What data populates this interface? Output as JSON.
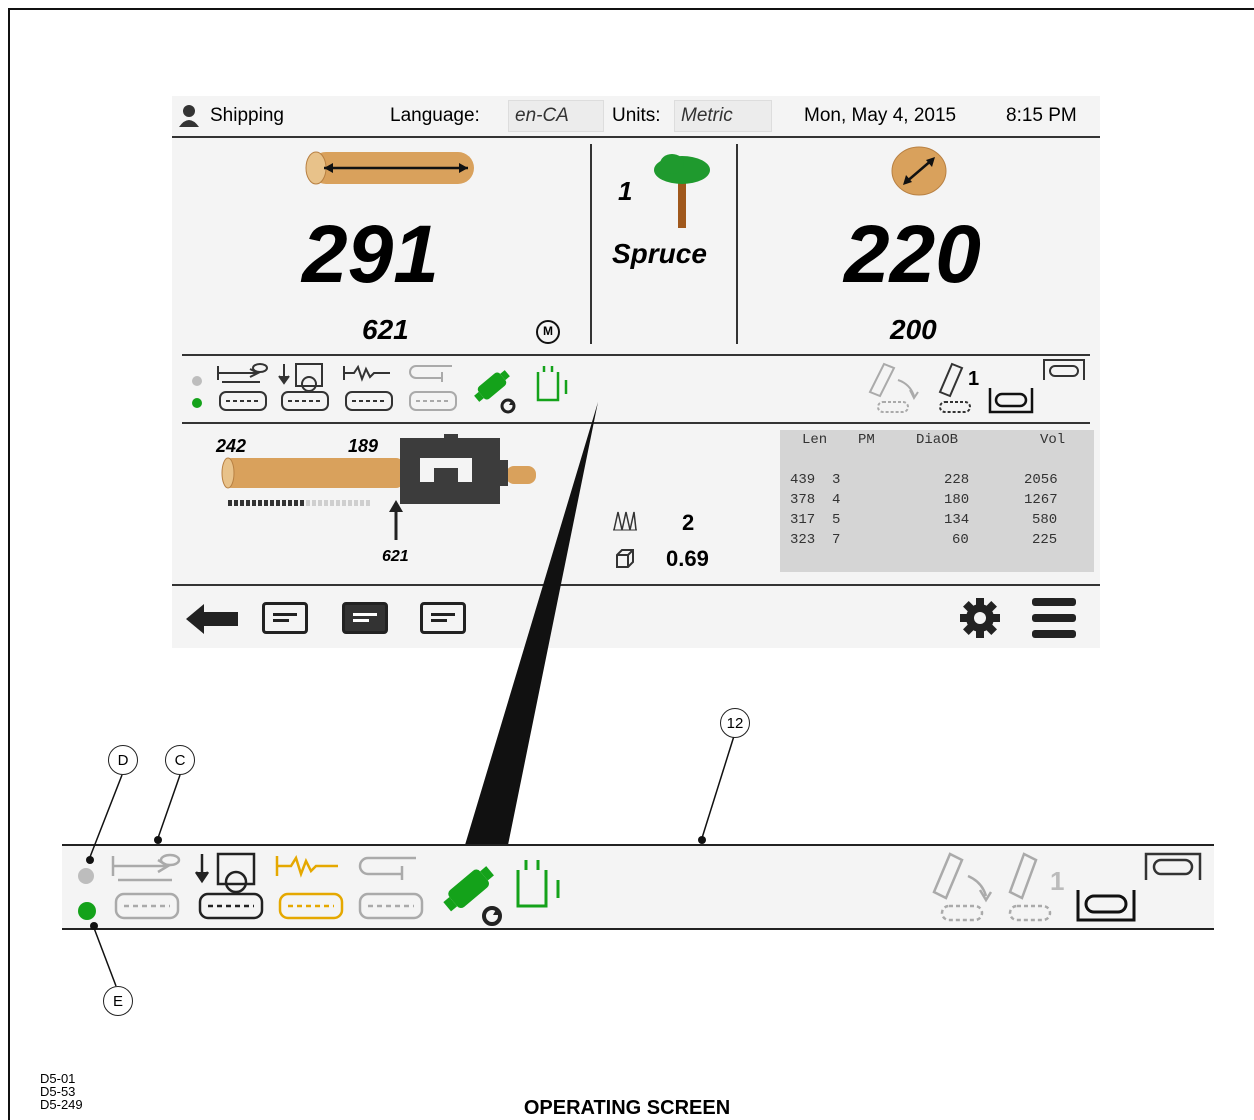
{
  "header": {
    "user_name": "Shipping",
    "language_label": "Language:",
    "language_value": "en-CA",
    "units_label": "Units:",
    "units_value": "Metric",
    "date": "Mon, May 4, 2015",
    "time": "8:15 PM"
  },
  "length": {
    "main": "291",
    "sub": "621",
    "mode_badge": "M"
  },
  "species": {
    "number": "1",
    "name": "Spruce"
  },
  "diameter": {
    "main": "220",
    "sub": "200"
  },
  "feed": {
    "top_left": "242",
    "top_right": "189",
    "bottom": "621"
  },
  "counters": {
    "count": "2",
    "volume": "0.69"
  },
  "cut_icon_number": "1",
  "table": {
    "headers": [
      "Len",
      "PM",
      "DiaOB",
      "Vol"
    ],
    "rows": [
      [
        "439",
        "3",
        "228",
        "2056"
      ],
      [
        "378",
        "4",
        "180",
        "1267"
      ],
      [
        "317",
        "5",
        "134",
        "580"
      ],
      [
        "323",
        "7",
        "60",
        "225"
      ]
    ]
  },
  "callouts": {
    "c12": "12",
    "d": "D",
    "c": "C",
    "e": "E"
  },
  "doc_refs": [
    "D5-01",
    "D5-53",
    "D5-249"
  ],
  "caption": "OPERATING SCREEN",
  "colors": {
    "wood": "#d9a15c",
    "tree_green": "#1f9a2e",
    "active_green": "#14a21a",
    "amber": "#e5a800",
    "panel": "#f4f4f4",
    "table_bg": "#d5d5d5"
  }
}
